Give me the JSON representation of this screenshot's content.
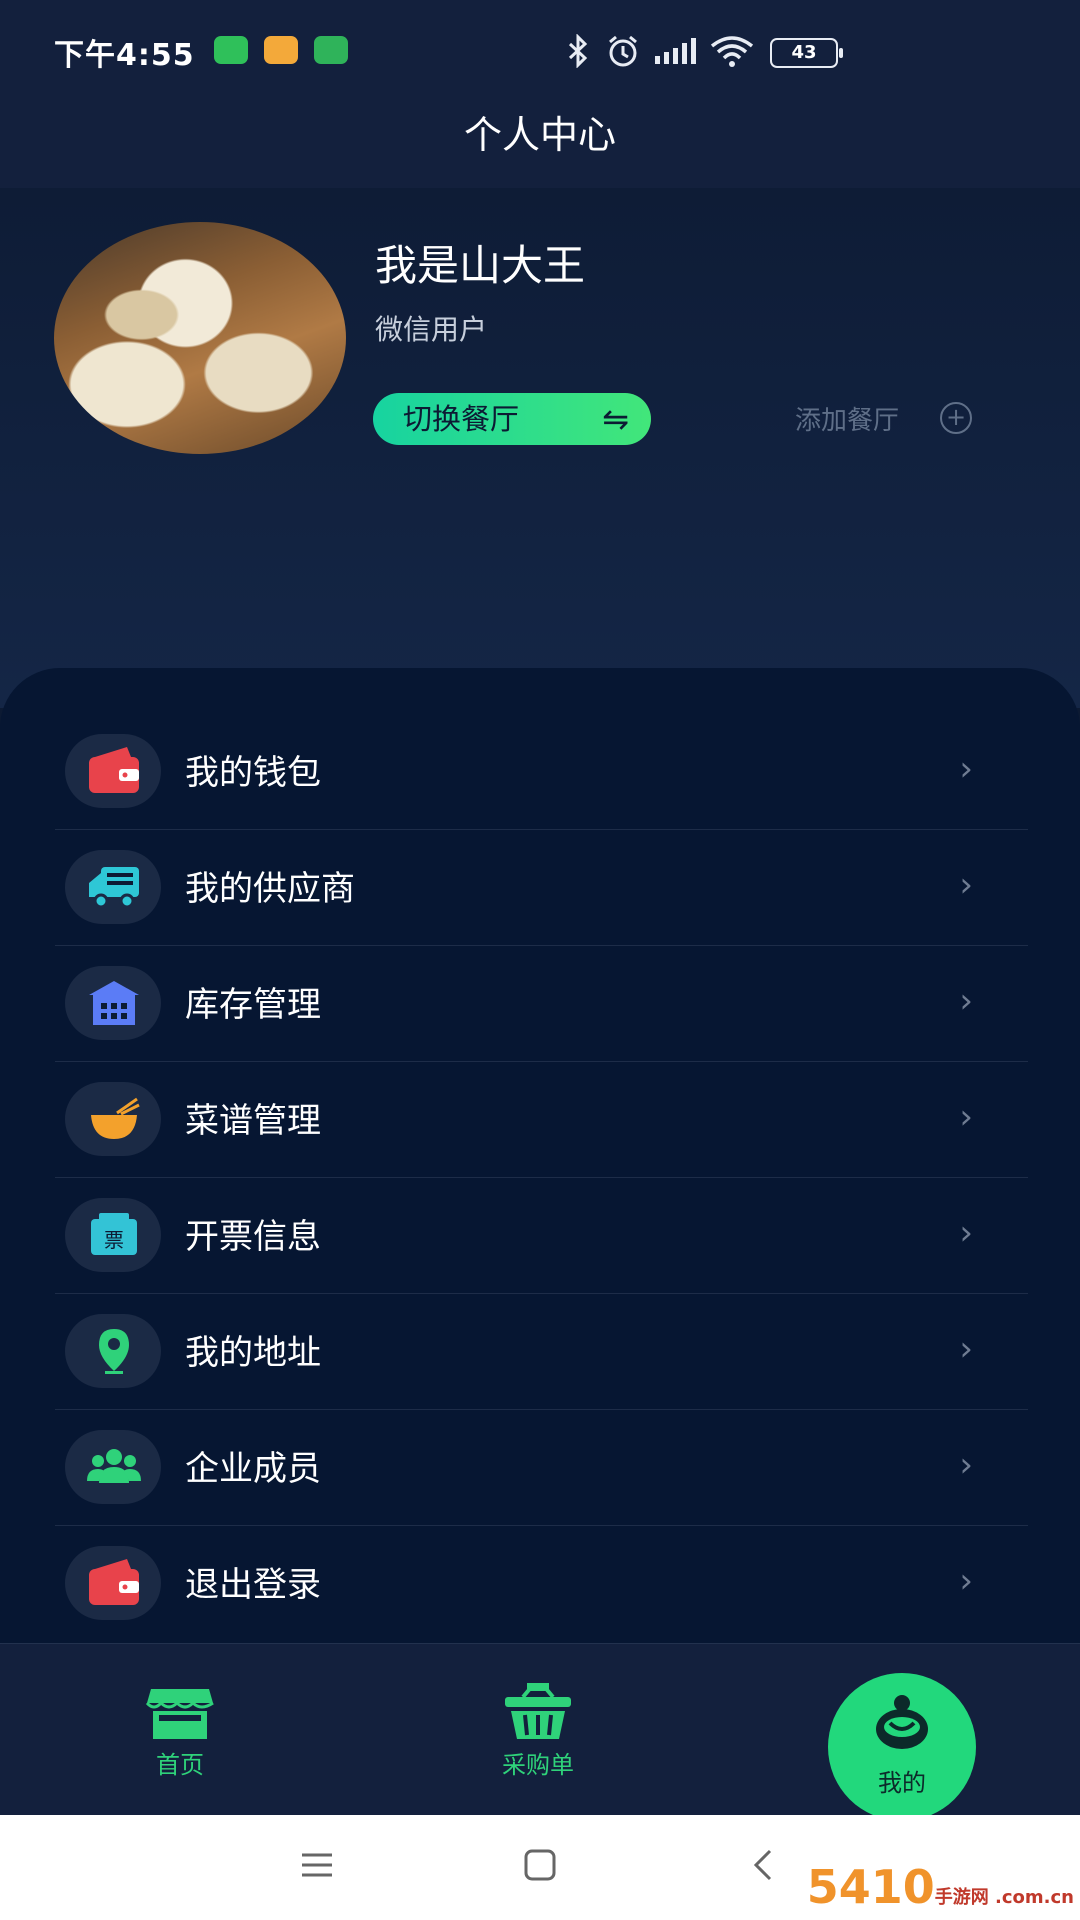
{
  "status": {
    "time": "下午4:55",
    "battery": "43",
    "app_icons": [
      "wechat-icon",
      "mail-icon",
      "phone-icon"
    ]
  },
  "header": {
    "title": "个人中心"
  },
  "profile": {
    "name": "我是山大王",
    "type": "微信用户",
    "switch_label": "切换餐厅",
    "switch_icon": "⇋",
    "add_label": "添加餐厅",
    "add_icon": "⊕"
  },
  "menu": [
    {
      "label": "我的钱包",
      "icon": "wallet-icon"
    },
    {
      "label": "我的供应商",
      "icon": "truck-icon"
    },
    {
      "label": "库存管理",
      "icon": "warehouse-icon"
    },
    {
      "label": "菜谱管理",
      "icon": "bowl-icon"
    },
    {
      "label": "开票信息",
      "icon": "ticket-icon"
    },
    {
      "label": "我的地址",
      "icon": "location-pin-icon"
    },
    {
      "label": "企业成员",
      "icon": "members-icon"
    },
    {
      "label": "退出登录",
      "icon": "logout-wallet-icon"
    }
  ],
  "chevron": "›",
  "tabs": [
    {
      "label": "首页",
      "icon": "shop-icon"
    },
    {
      "label": "采购单",
      "icon": "basket-icon"
    },
    {
      "label": "我的",
      "icon": "chef-icon"
    }
  ],
  "colors": {
    "accent": "#22d87c",
    "background": "#0c1a33",
    "panel": "#061632"
  },
  "watermark": {
    "text": "5410",
    "sub": "手游网 .com.cn"
  }
}
